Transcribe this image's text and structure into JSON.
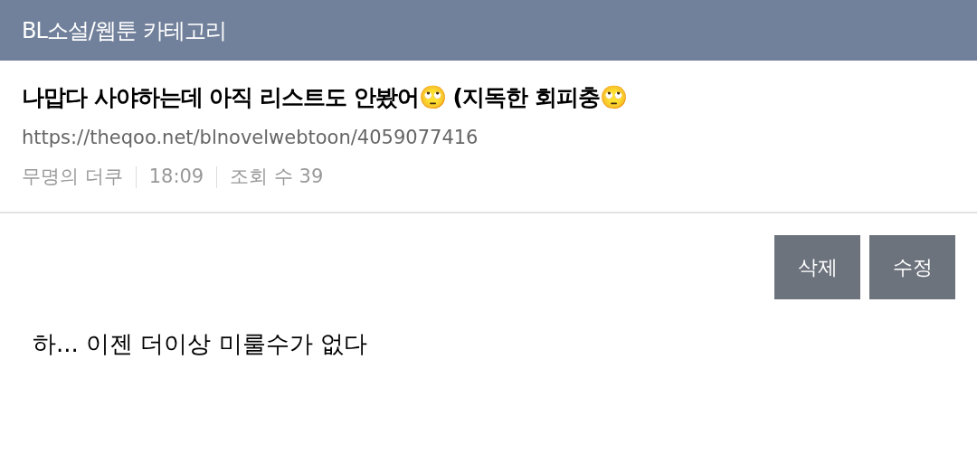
{
  "header": {
    "title": "BL소설/웹툰 카테고리"
  },
  "post": {
    "title": "나맙다 사야하는데 아직 리스트도 안봤어🙄 (지독한 회피충🙄",
    "url": "https://theqoo.net/blnovelwebtoon/4059077416",
    "meta": [
      "무명의 더쿠",
      "18:09",
      "조회 수 39"
    ]
  },
  "buttons": [
    "삭제",
    "수정"
  ],
  "body": "하... 이젠 더이상 미룰수가 없다"
}
